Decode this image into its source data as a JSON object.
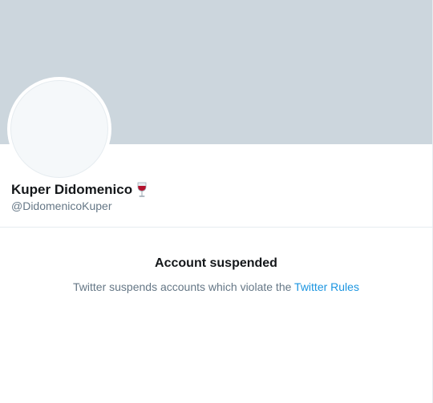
{
  "profile": {
    "name": "Kuper Didomenico",
    "name_emoji_icon": "wine-glass-icon",
    "handle": "@DidomenicoKuper"
  },
  "notice": {
    "title": "Account suspended",
    "description": "Twitter suspends accounts which violate the",
    "link_text": "Twitter Rules"
  },
  "colors": {
    "banner": "#ccd6dd",
    "link": "#1b95e0",
    "secondary_text": "#657786"
  }
}
